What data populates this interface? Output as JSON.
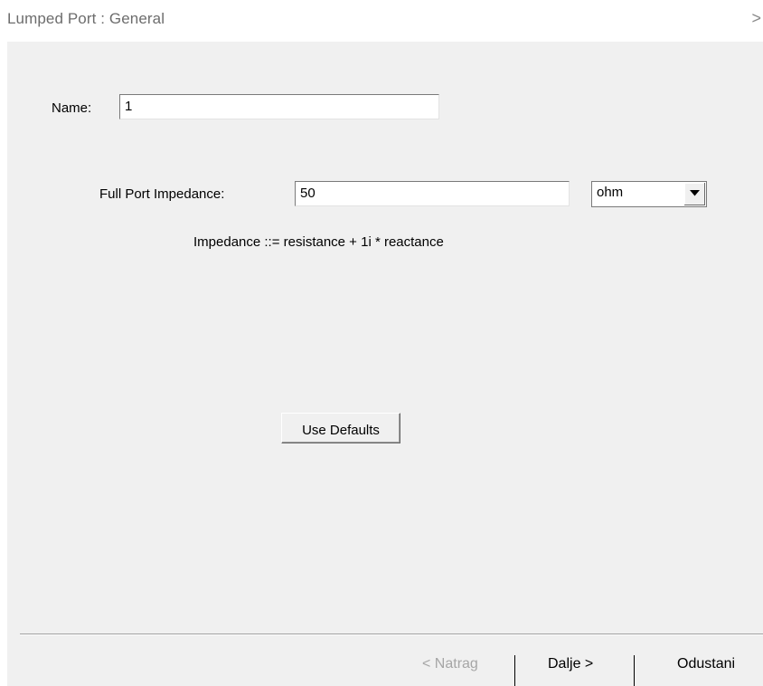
{
  "header": {
    "title": "Lumped Port : General",
    "chevron": ">"
  },
  "form": {
    "name_label": "Name:",
    "name_value": "1",
    "impedance_label": "Full Port Impedance:",
    "impedance_value": "50",
    "unit_selected": "ohm",
    "impedance_hint": "Impedance ::= resistance + 1i * reactance",
    "use_defaults_label": "Use Defaults"
  },
  "footer": {
    "back_label": "< Natrag",
    "next_label": "Dalje >",
    "cancel_label": "Odustani"
  },
  "icons": {
    "dropdown": "chevron-down-icon",
    "header": "chevron-right-icon"
  },
  "colors": {
    "panel_bg": "#f0f0f0",
    "header_text": "#6d6d6d",
    "disabled_text": "#a6a6a6"
  }
}
